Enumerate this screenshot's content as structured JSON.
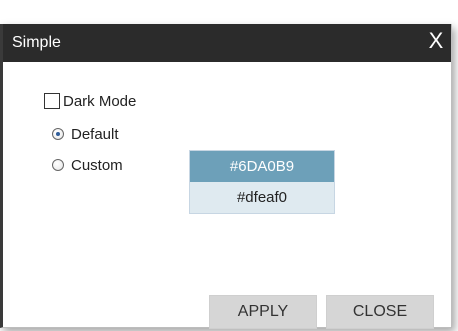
{
  "window": {
    "title": "Simple",
    "close_glyph": "X"
  },
  "options": {
    "dark_mode_label": "Dark Mode",
    "dark_mode_checked": false,
    "radios": [
      {
        "label": "Default",
        "selected": true
      },
      {
        "label": "Custom",
        "selected": false
      }
    ]
  },
  "colors": {
    "items": [
      {
        "label": "#6DA0B9",
        "selected": true
      },
      {
        "label": "#dfeaf0",
        "selected": false
      }
    ],
    "selected_bg": "#6DA0B9",
    "unselected_bg": "#dfeaf0"
  },
  "buttons": {
    "apply_label": "APPLY",
    "close_label": "CLOSE"
  },
  "icons": {
    "close": "close-icon",
    "checkbox": "checkbox-icon",
    "radio": "radio-icon"
  }
}
